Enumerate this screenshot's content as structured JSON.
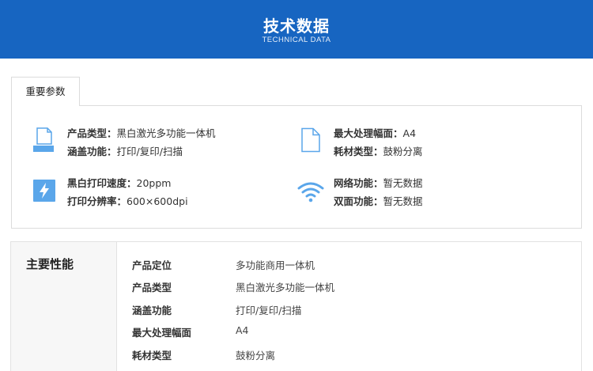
{
  "header": {
    "title": "技术数据",
    "subtitle": "TECHNICAL DATA"
  },
  "tab": {
    "label": "重要参数"
  },
  "params": [
    {
      "icon": "printer-icon",
      "lines": [
        {
          "label": "产品类型：",
          "value": "黑白激光多功能一体机"
        },
        {
          "label": "涵盖功能：",
          "value": "打印/复印/扫描"
        }
      ]
    },
    {
      "icon": "document-icon",
      "lines": [
        {
          "label": "最大处理幅面：",
          "value": "A4"
        },
        {
          "label": "耗材类型：",
          "value": "鼓粉分离"
        }
      ]
    },
    {
      "icon": "lightning-icon",
      "lines": [
        {
          "label": "黑白打印速度：",
          "value": "20ppm"
        },
        {
          "label": "打印分辨率：",
          "value": "600×600dpi"
        }
      ]
    },
    {
      "icon": "wifi-icon",
      "lines": [
        {
          "label": "网络功能：",
          "value": "暂无数据"
        },
        {
          "label": "双面功能：",
          "value": "暂无数据"
        }
      ]
    }
  ],
  "performance": {
    "title": "主要性能",
    "rows": [
      {
        "label": "产品定位",
        "value": "多功能商用一体机"
      },
      {
        "label": "产品类型",
        "value": "黑白激光多功能一体机"
      },
      {
        "label": "涵盖功能",
        "value": "打印/复印/扫描"
      },
      {
        "label": "最大处理幅面",
        "value": "A4"
      },
      {
        "label": "耗材类型",
        "value": "鼓粉分离"
      }
    ]
  },
  "colors": {
    "header_bg": "#1765c1",
    "icon_blue": "#5aa6ea",
    "border": "#dcdcdc"
  }
}
